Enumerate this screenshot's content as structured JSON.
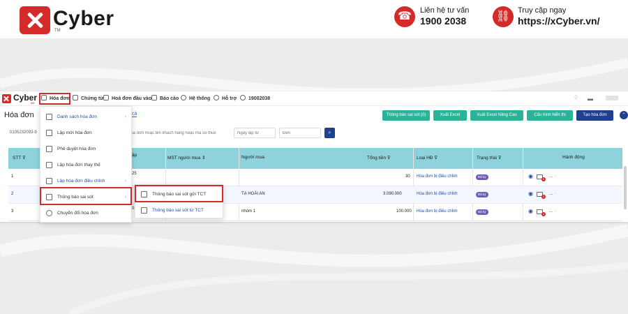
{
  "banner": {
    "brand": "Cyber",
    "trademark": "TM",
    "hotline_label": "Liên hệ tư vấn",
    "hotline_value": "1900 2038",
    "site_label": "Truy cập ngay",
    "site_value": "https://xCyber.vn/"
  },
  "app": {
    "logo_text": "Cyber",
    "logo_sub": "Bill",
    "nav": {
      "invoice": "Hóa đơn",
      "voucher": "Chứng từ",
      "input_invoice": "Hoá đơn đầu vào",
      "report": "Báo cáo",
      "system": "Hệ thống",
      "support": "Hỗ trợ",
      "phone": "19002038"
    },
    "page_title": "Hóa đơn",
    "tab_fragment": "cả",
    "buttons": {
      "error_notice": "Thông báo sai sót (0)",
      "export_excel": "Xuất Excel",
      "export_excel_adv": "Xuất Excel Nâng Cao",
      "display_config": "Cấu hình hiển thị",
      "create_invoice": "Tạo hóa đơn"
    },
    "filter": {
      "mst_value": "0105232093-9",
      "search_placeholder": "hóa đơn hoặc tên khách hàng hoặc mã số thuế",
      "from_placeholder": "Ngày lập từ",
      "to_placeholder": "Đến"
    },
    "table": {
      "headers": {
        "stt": "STT",
        "date_frag": "ập",
        "mst": "MST người mua",
        "buyer": "Người mua",
        "total": "Tổng tiền",
        "type": "Loại HĐ",
        "status": "Trạng thái",
        "action": "Hành động"
      },
      "rows": [
        {
          "stt": "1",
          "date_frag": "25",
          "buyer": "",
          "total": "30",
          "type": "Hóa đơn bị điều chỉnh",
          "status": "Đã ký"
        },
        {
          "stt": "2",
          "date_frag": "",
          "buyer": "TẠ HOÀI AN",
          "total": "3.090.000",
          "type": "Hóa đơn bị điều chỉnh",
          "status": "Đã ký"
        },
        {
          "stt": "3",
          "date_frag": "02",
          "buyer": "nhóm 1",
          "total": "100.000",
          "type": "Hóa đơn bị điều chỉnh",
          "status": "Đã ký"
        }
      ]
    },
    "menu": {
      "items": [
        {
          "label": "Danh sách hóa đơn",
          "blue": true,
          "chevron": true
        },
        {
          "label": "Lập mới hóa đơn",
          "blue": false,
          "chevron": false
        },
        {
          "label": "Phê duyệt hóa đơn",
          "blue": false,
          "chevron": false
        },
        {
          "label": "Lập hóa đơn thay thế",
          "blue": false,
          "chevron": false
        },
        {
          "label": "Lập hóa đơn điều chỉnh",
          "blue": true,
          "chevron": true
        },
        {
          "label": "Thông báo sai sót",
          "blue": false,
          "chevron": true
        },
        {
          "label": "Chuyển đổi hóa đơn",
          "blue": false,
          "chevron": false
        }
      ],
      "submenu": [
        {
          "label": "Thông báo sai sót gửi TCT"
        },
        {
          "label": "Thông báo sai sót từ TCT"
        }
      ]
    },
    "icons": {
      "accent": "#d42a2a",
      "teal": "#2bb39a",
      "navy": "#1f3f8f",
      "header_bg": "#8ed3dc"
    }
  }
}
